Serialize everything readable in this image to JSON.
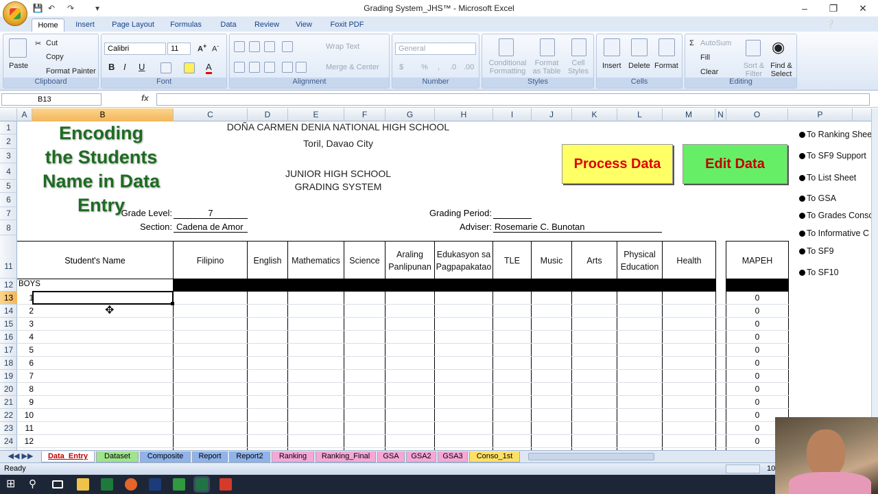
{
  "window": {
    "title": "Grading System_JHS™ - Microsoft Excel"
  },
  "ribbon": {
    "tabs": [
      "Home",
      "Insert",
      "Page Layout",
      "Formulas",
      "Data",
      "Review",
      "View",
      "Foxit PDF"
    ],
    "clipboard": {
      "paste": "Paste",
      "cut": "Cut",
      "copy": "Copy",
      "format_painter": "Format Painter",
      "label": "Clipboard"
    },
    "font": {
      "name": "Calibri",
      "size": "11",
      "label": "Font"
    },
    "alignment": {
      "wrap": "Wrap Text",
      "merge": "Merge & Center",
      "label": "Alignment"
    },
    "number": {
      "format": "General",
      "label": "Number"
    },
    "styles": {
      "conditional": "Conditional Formatting",
      "format_table": "Format as Table",
      "cell_styles": "Cell Styles",
      "label": "Styles"
    },
    "cells": {
      "insert": "Insert",
      "delete": "Delete",
      "format": "Format",
      "label": "Cells"
    },
    "editing": {
      "autosum": "AutoSum",
      "fill": "Fill",
      "clear": "Clear",
      "sort": "Sort & Filter",
      "find": "Find & Select",
      "label": "Editing"
    }
  },
  "formula_bar": {
    "cell": "B13",
    "fx": "fx",
    "value": ""
  },
  "columns": [
    "A",
    "B",
    "C",
    "D",
    "E",
    "F",
    "G",
    "H",
    "I",
    "J",
    "K",
    "L",
    "M",
    "N",
    "O",
    "P"
  ],
  "rows": [
    "1",
    "2",
    "3",
    "4",
    "5",
    "6",
    "7",
    "8",
    "11",
    "12",
    "13",
    "14",
    "15",
    "16",
    "17",
    "18",
    "19",
    "20",
    "21",
    "22",
    "23",
    "24"
  ],
  "sheet": {
    "overlay_title": [
      "Encoding",
      "the Students",
      "Name in Data Entry"
    ],
    "school": "DOÑA CARMEN DENIA NATIONAL HIGH SCHOOL",
    "location": "Toril, Davao City",
    "jhs": "JUNIOR HIGH SCHOOL",
    "system": "GRADING SYSTEM",
    "grade_label": "Grade Level:",
    "grade_value": "7",
    "section_label": "Section:",
    "section_value": "Cadena de Amor",
    "period_label": "Grading Period:",
    "adviser_label": "Adviser:",
    "adviser_value": "Rosemarie C. Bunotan",
    "process_btn": "Process Data",
    "edit_btn": "Edit Data",
    "student_header": "Student's Name",
    "subjects": [
      "Filipino",
      "English",
      "Mathematics",
      "Science",
      "Araling Panlipunan",
      "Edukasyon sa Pagpapakatao",
      "TLE",
      "Music",
      "Arts",
      "Physical Education",
      "Health"
    ],
    "mapeh": "MAPEH",
    "boys": "BOYS",
    "numbers": [
      "1",
      "2",
      "3",
      "4",
      "5",
      "6",
      "7",
      "8",
      "9",
      "10",
      "11",
      "12"
    ],
    "mapeh_values": [
      "0",
      "0",
      "0",
      "0",
      "0",
      "0",
      "0",
      "0",
      "0",
      "0",
      "0",
      "0"
    ],
    "links": [
      "To Ranking Shee",
      "To SF9 Support",
      "To List Sheet",
      "To GSA",
      "To Grades Conso",
      "To Informative C",
      "To SF9",
      "To SF10"
    ]
  },
  "sheet_tabs": [
    "Data_Entry",
    "Dataset",
    "Composite",
    "Report",
    "Report2",
    "Ranking",
    "Ranking_Final",
    "GSA",
    "GSA2",
    "GSA3",
    "Conso_1st"
  ],
  "status": {
    "ready": "Ready",
    "zoom": "10"
  }
}
